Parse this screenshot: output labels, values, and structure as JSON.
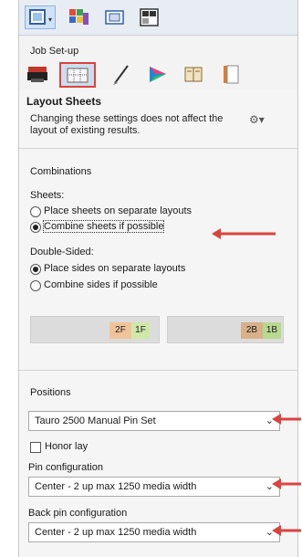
{
  "toolbar": {
    "icons": [
      "layout-view-icon",
      "color-swatches-icon",
      "media-icon",
      "tile-grid-icon"
    ],
    "dropdown_glyph": "▾"
  },
  "section": {
    "label": "Job Set-up"
  },
  "tabs": [
    {
      "name": "printer-tab",
      "icon": "printer-icon"
    },
    {
      "name": "layout-sheets-tab",
      "icon": "layout-sheets-icon",
      "selected": true
    },
    {
      "name": "pen-tab",
      "icon": "pen-icon"
    },
    {
      "name": "color-tab",
      "icon": "color-wheel-icon"
    },
    {
      "name": "book-tab",
      "icon": "book-icon"
    },
    {
      "name": "pages-tab",
      "icon": "pages-icon"
    }
  ],
  "panel": {
    "title": "Layout Sheets",
    "description": "Changing these settings does not affect the layout of existing results.",
    "gear_glyph": "⚙▾",
    "combinations_label": "Combinations",
    "sheets_label": "Sheets:",
    "sheets_options": [
      "Place sheets on separate layouts",
      "Combine sheets if possible"
    ],
    "sheets_selected": "Combine sheets if possible",
    "double_sided_label": "Double-Sided:",
    "double_sided_options": [
      "Place sides on separate layouts",
      "Combine sides if possible"
    ],
    "double_sided_selected": "Place sides on separate layouts",
    "front_tags": [
      "2F",
      "1F"
    ],
    "back_tags": [
      "2B",
      "1B"
    ],
    "positions_label": "Positions",
    "positions_value": "Tauro 2500 Manual Pin Set",
    "honor_lay_label": "Honor lay",
    "honor_lay_checked": false,
    "pin_config_label": "Pin configuration",
    "pin_config_value": "Center - 2 up max 1250 media width",
    "back_pin_config_label": "Back pin configuration",
    "back_pin_config_value": "Center - 2 up max 1250 media width",
    "chevron_glyph": "⌄"
  },
  "colors": {
    "annotation_red": "#d9443f",
    "tag_orange": "#f0c49a",
    "tag_green": "#cfe8a8",
    "tag_orange_b": "#d8b08a",
    "tag_green_b": "#b8d890"
  }
}
